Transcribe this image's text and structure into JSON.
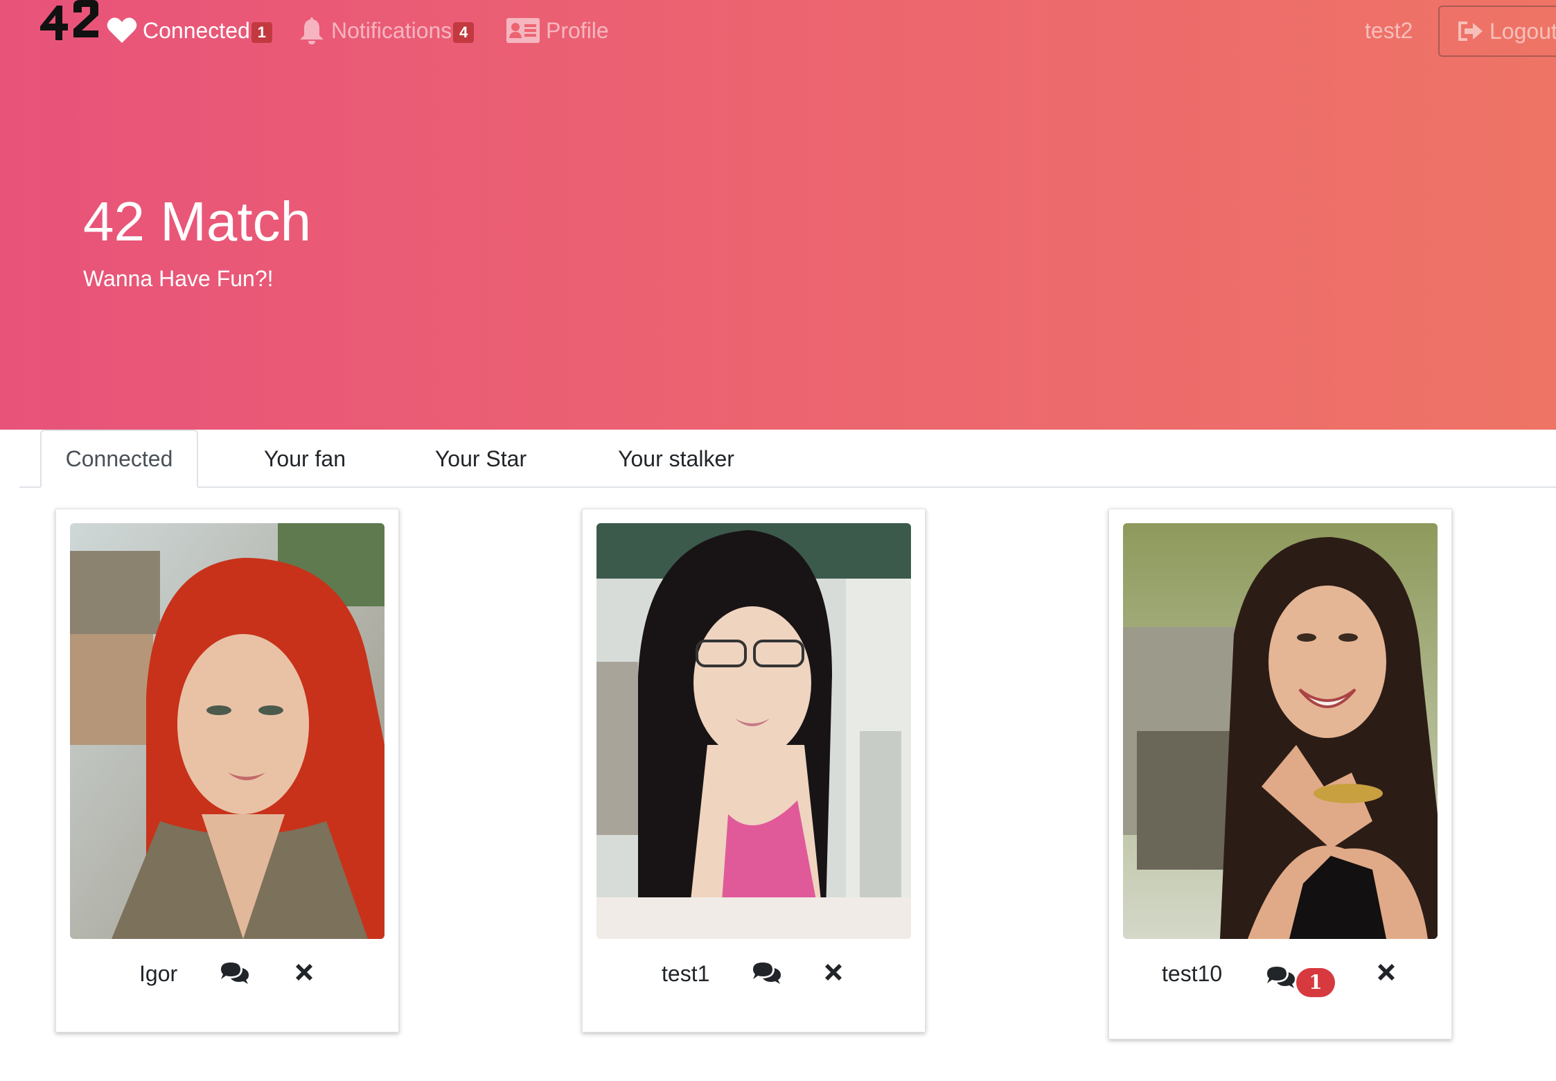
{
  "navbar": {
    "logo": "42",
    "items": [
      {
        "label": "Connected",
        "badge": "1",
        "icon": "heart-icon"
      },
      {
        "label": "Notifications",
        "badge": "4",
        "icon": "bell-icon"
      },
      {
        "label": "Profile",
        "icon": "id-card-icon"
      }
    ],
    "username": "test2",
    "logout_label": "Logout",
    "logout_icon": "sign-out-icon"
  },
  "hero": {
    "title": "42 Match",
    "subtitle": "Wanna Have Fun?!"
  },
  "tabs": [
    {
      "label": "Connected",
      "active": true
    },
    {
      "label": "Your fan"
    },
    {
      "label": "Your Star"
    },
    {
      "label": "Your stalker"
    }
  ],
  "cards": [
    {
      "name": "Igor",
      "chat_icon": "comments-icon",
      "remove_icon": "close-icon"
    },
    {
      "name": "test1",
      "chat_icon": "comments-icon",
      "remove_icon": "close-icon"
    },
    {
      "name": "test10",
      "chat_icon": "comments-icon",
      "unread": "1",
      "remove_icon": "close-icon"
    }
  ],
  "colors": {
    "hero_start": "#e8537a",
    "hero_end": "#ee7466",
    "badge": "#c23a3f",
    "unread_badge": "#d63a3f"
  }
}
